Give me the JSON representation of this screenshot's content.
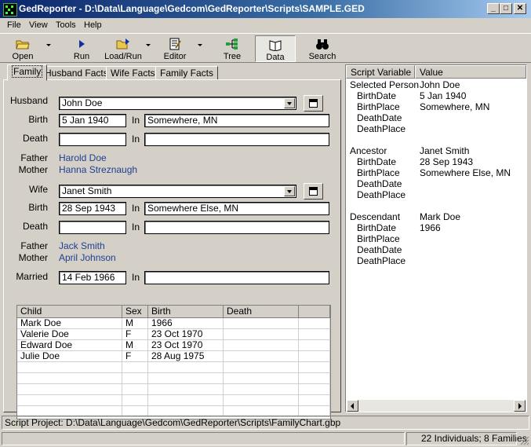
{
  "window": {
    "title": "GedReporter - D:\\Data\\Language\\Gedcom\\GedReporter\\Scripts\\SAMPLE.GED"
  },
  "menu": [
    {
      "label": "File"
    },
    {
      "label": "View"
    },
    {
      "label": "Tools"
    },
    {
      "label": "Help"
    }
  ],
  "toolbar": {
    "open": "Open",
    "run": "Run",
    "loadrun": "Load/Run",
    "editor": "Editor",
    "tree": "Tree",
    "data": "Data",
    "search": "Search"
  },
  "tabs": [
    "Family",
    "Husband Facts",
    "Wife Facts",
    "Family Facts"
  ],
  "family": {
    "husband_label": "Husband",
    "husband": "John Doe",
    "birth_label": "Birth",
    "in_label": "In",
    "death_label": "Death",
    "father_label": "Father",
    "mother_label": "Mother",
    "husband_birth_date": "5 Jan 1940",
    "husband_birth_place": "Somewhere, MN",
    "husband_death_date": "",
    "husband_death_place": "",
    "husband_father": "Harold Doe",
    "husband_mother": "Hanna Streznaugh",
    "wife_label": "Wife",
    "wife": "Janet Smith",
    "wife_birth_date": "28 Sep 1943",
    "wife_birth_place": "Somewhere Else, MN",
    "wife_death_date": "",
    "wife_death_place": "",
    "wife_father": "Jack Smith",
    "wife_mother": "April Johnson",
    "married_label": "Married",
    "married_date": "14 Feb 1966",
    "married_place": ""
  },
  "children": {
    "headers": [
      "Child",
      "Sex",
      "Birth",
      "Death"
    ],
    "rows": [
      [
        "Mark Doe",
        "M",
        "1966",
        ""
      ],
      [
        "Valerie Doe",
        "F",
        "23 Oct 1970",
        ""
      ],
      [
        "Edward Doe",
        "M",
        "23 Oct 1970",
        ""
      ],
      [
        "Julie Doe",
        "F",
        "28 Aug 1975",
        ""
      ]
    ]
  },
  "script_vars": {
    "headers": [
      "Script Variable",
      "Value"
    ],
    "rows": [
      [
        "Selected Person",
        "John Doe",
        0
      ],
      [
        "BirthDate",
        "5 Jan 1940",
        1
      ],
      [
        "BirthPlace",
        "Somewhere, MN",
        1
      ],
      [
        "DeathDate",
        "",
        1
      ],
      [
        "DeathPlace",
        "",
        1
      ],
      [
        "",
        "",
        0
      ],
      [
        "Ancestor",
        "Janet Smith",
        0
      ],
      [
        "BirthDate",
        "28 Sep 1943",
        1
      ],
      [
        "BirthPlace",
        "Somewhere Else, MN",
        1
      ],
      [
        "DeathDate",
        "",
        1
      ],
      [
        "DeathPlace",
        "",
        1
      ],
      [
        "",
        "",
        0
      ],
      [
        "Descendant",
        "Mark Doe",
        0
      ],
      [
        "BirthDate",
        "1966",
        1
      ],
      [
        "BirthPlace",
        "",
        1
      ],
      [
        "DeathDate",
        "",
        1
      ],
      [
        "DeathPlace",
        "",
        1
      ]
    ]
  },
  "status": {
    "project": "Script Project: D:\\Data\\Language\\Gedcom\\GedReporter\\Scripts\\FamilyChart.gbp",
    "counts": "22 Individuals; 8 Families"
  }
}
